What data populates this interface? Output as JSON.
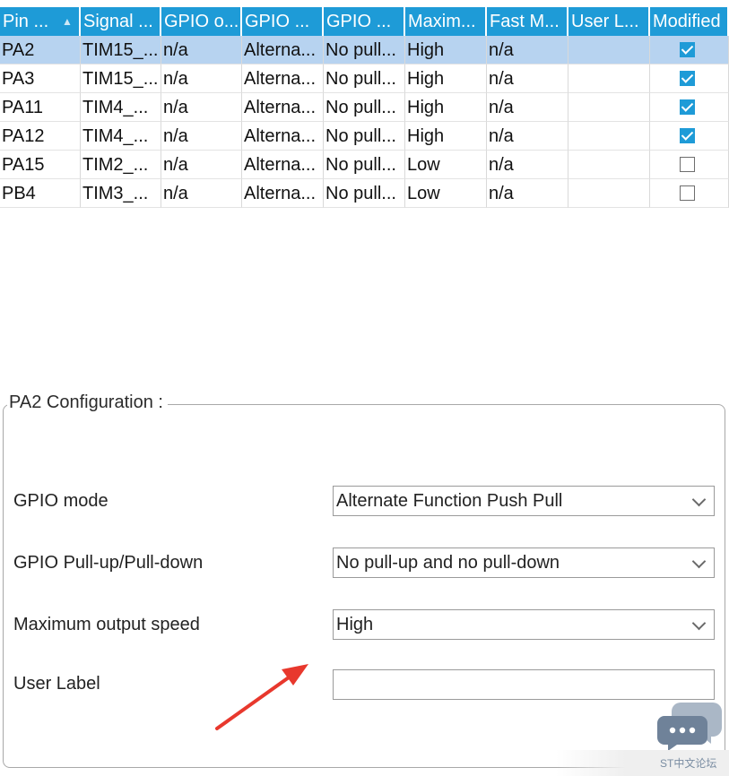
{
  "table": {
    "headers": [
      "Pin ...",
      "Signal ...",
      "GPIO o...",
      "GPIO ...",
      "GPIO ...",
      "Maxim...",
      "Fast M...",
      "User L...",
      "Modified"
    ],
    "rows": [
      {
        "pin": "PA2",
        "signal": "TIM15_...",
        "gpio_output": "n/a",
        "gpio_mode": "Alterna...",
        "gpio_pull": "No pull...",
        "max_speed": "High",
        "fast_mode": "n/a",
        "user_label": "",
        "modified": true,
        "selected": true
      },
      {
        "pin": "PA3",
        "signal": "TIM15_...",
        "gpio_output": "n/a",
        "gpio_mode": "Alterna...",
        "gpio_pull": "No pull...",
        "max_speed": "High",
        "fast_mode": "n/a",
        "user_label": "",
        "modified": true,
        "selected": false
      },
      {
        "pin": "PA11",
        "signal": "TIM4_...",
        "gpio_output": "n/a",
        "gpio_mode": "Alterna...",
        "gpio_pull": "No pull...",
        "max_speed": "High",
        "fast_mode": "n/a",
        "user_label": "",
        "modified": true,
        "selected": false
      },
      {
        "pin": "PA12",
        "signal": "TIM4_...",
        "gpio_output": "n/a",
        "gpio_mode": "Alterna...",
        "gpio_pull": "No pull...",
        "max_speed": "High",
        "fast_mode": "n/a",
        "user_label": "",
        "modified": true,
        "selected": false
      },
      {
        "pin": "PA15",
        "signal": "TIM2_...",
        "gpio_output": "n/a",
        "gpio_mode": "Alterna...",
        "gpio_pull": "No pull...",
        "max_speed": "Low",
        "fast_mode": "n/a",
        "user_label": "",
        "modified": false,
        "selected": false
      },
      {
        "pin": "PB4",
        "signal": "TIM3_...",
        "gpio_output": "n/a",
        "gpio_mode": "Alterna...",
        "gpio_pull": "No pull...",
        "max_speed": "Low",
        "fast_mode": "n/a",
        "user_label": "",
        "modified": false,
        "selected": false
      }
    ],
    "sort_icon": "sort-ascending-icon"
  },
  "config": {
    "title": "PA2 Configuration :",
    "gpio_mode": {
      "label": "GPIO mode",
      "value": "Alternate Function Push Pull"
    },
    "pull": {
      "label": "GPIO Pull-up/Pull-down",
      "value": "No pull-up and no pull-down"
    },
    "speed": {
      "label": "Maximum output speed",
      "value": "High"
    },
    "user_label": {
      "label": "User Label",
      "value": ""
    }
  },
  "annotation": {
    "arrow_color": "#e8382d"
  },
  "watermark": {
    "text": "ST中文论坛",
    "icon": "chat-bubble-icon"
  },
  "colors": {
    "header_bg": "#1e9bd7",
    "selected_row_bg": "#b7d3f0",
    "checkbox_on": "#1e9bd7"
  }
}
